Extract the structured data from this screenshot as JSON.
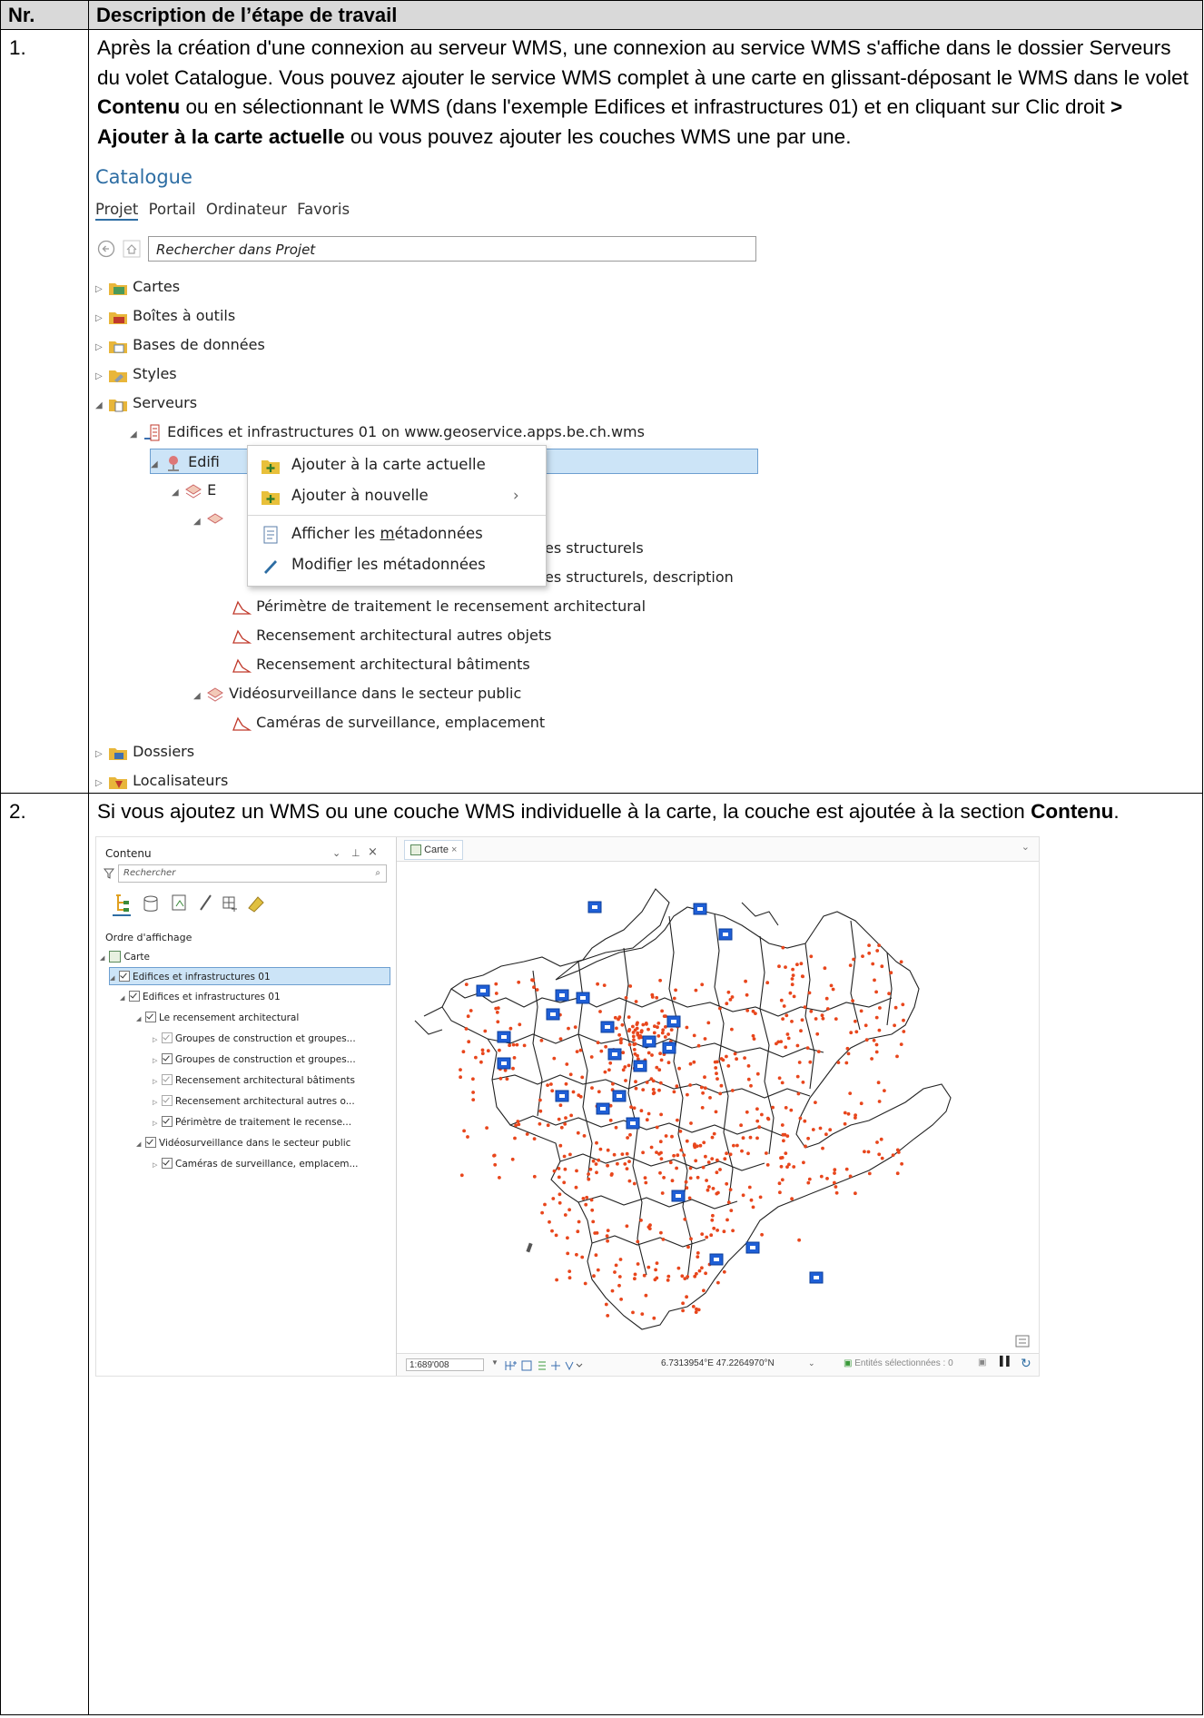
{
  "header": {
    "nr": "Nr.",
    "description": "Description de l’étape de travail"
  },
  "steps": [
    {
      "nr": "1.",
      "text_plain_1": "Après la création d'une connexion au serveur WMS, une connexion au service WMS s'affiche dans le dossier Serveurs du volet Catalogue. Vous pouvez ajouter le service WMS complet à une carte en glissant-déposant le WMS dans le volet ",
      "text_bold_1": "Contenu",
      "text_plain_2": " ou en sélectionnant le WMS (dans l'exemple Edifices et infrastructures 01) et en cliquant sur Clic droit ",
      "text_bold_2": "> Ajouter à la carte actuelle",
      "text_plain_3": " ou vous pouvez ajouter les couches WMS une par une."
    },
    {
      "nr": "2.",
      "text_plain_1": "Si vous ajoutez un WMS ou une couche WMS individuelle à la carte, la couche est ajoutée à la section ",
      "text_bold_1": "Contenu",
      "text_plain_2": "."
    }
  ],
  "catalogue": {
    "title": "Catalogue",
    "tabs": [
      "Projet",
      "Portail",
      "Ordinateur",
      "Favoris"
    ],
    "search_placeholder": "Rechercher dans Projet",
    "tree": {
      "cartes": "Cartes",
      "boites": "Boîtes à outils",
      "bases": "Bases de données",
      "styles": "Styles",
      "serveurs": "Serveurs",
      "wms_connection": "Edifices et infrastructures 01 on www.geoservice.apps.be.ch.wms",
      "wms_service_partial": "Edifi",
      "sub_layer_partial": "E",
      "layer_partial_1": "es structurels",
      "layer_partial_2": "es structurels, description",
      "perimetre": "Périmètre de traitement le recensement architectural",
      "autres_objets": "Recensement architectural autres objets",
      "batiments": "Recensement architectural bâtiments",
      "video": "Vidéosurveillance dans le secteur public",
      "cameras": "Caméras de surveillance, emplacement",
      "dossiers": "Dossiers",
      "localisateurs": "Localisateurs"
    },
    "context_menu": {
      "add_current": "Ajouter à la carte actuelle",
      "add_new": "Ajouter à nouvelle",
      "view_meta_pre": "Afficher les ",
      "view_meta_ul": "m",
      "view_meta_post": "étadonnées",
      "edit_meta_pre": "Modifi",
      "edit_meta_ul": "e",
      "edit_meta_post": "r les métadonnées"
    }
  },
  "contents_pane": {
    "title": "Contenu",
    "search_placeholder": "Rechercher",
    "order_label": "Ordre d'affichage",
    "map_tab": "Carte",
    "layers": {
      "carte": "Carte",
      "wms": "Edifices et infrastructures 01",
      "wms_sub": "Edifices et infrastructures 01",
      "recensement": "Le recensement architectural",
      "groupes1": "Groupes de construction et groupes...",
      "groupes2": "Groupes de construction et groupes...",
      "batiments": "Recensement architectural bâtiments",
      "autres": "Recensement architectural autres o...",
      "perimetre": "Périmètre de traitement le recense...",
      "video": "Vidéosurveillance dans le secteur public",
      "cameras": "Caméras de surveillance, emplacem..."
    }
  },
  "status_bar": {
    "scale": "1:689'008",
    "coordinates": "6.7313954°E 47.2264970°N",
    "selected": "Entités sélectionnées : 0"
  },
  "colors": {
    "header_bg": "#d9d9d9",
    "accent": "#2d6da3",
    "selection": "#cce4f7",
    "point": "#e8461c",
    "camera": "#1f5fd6"
  }
}
